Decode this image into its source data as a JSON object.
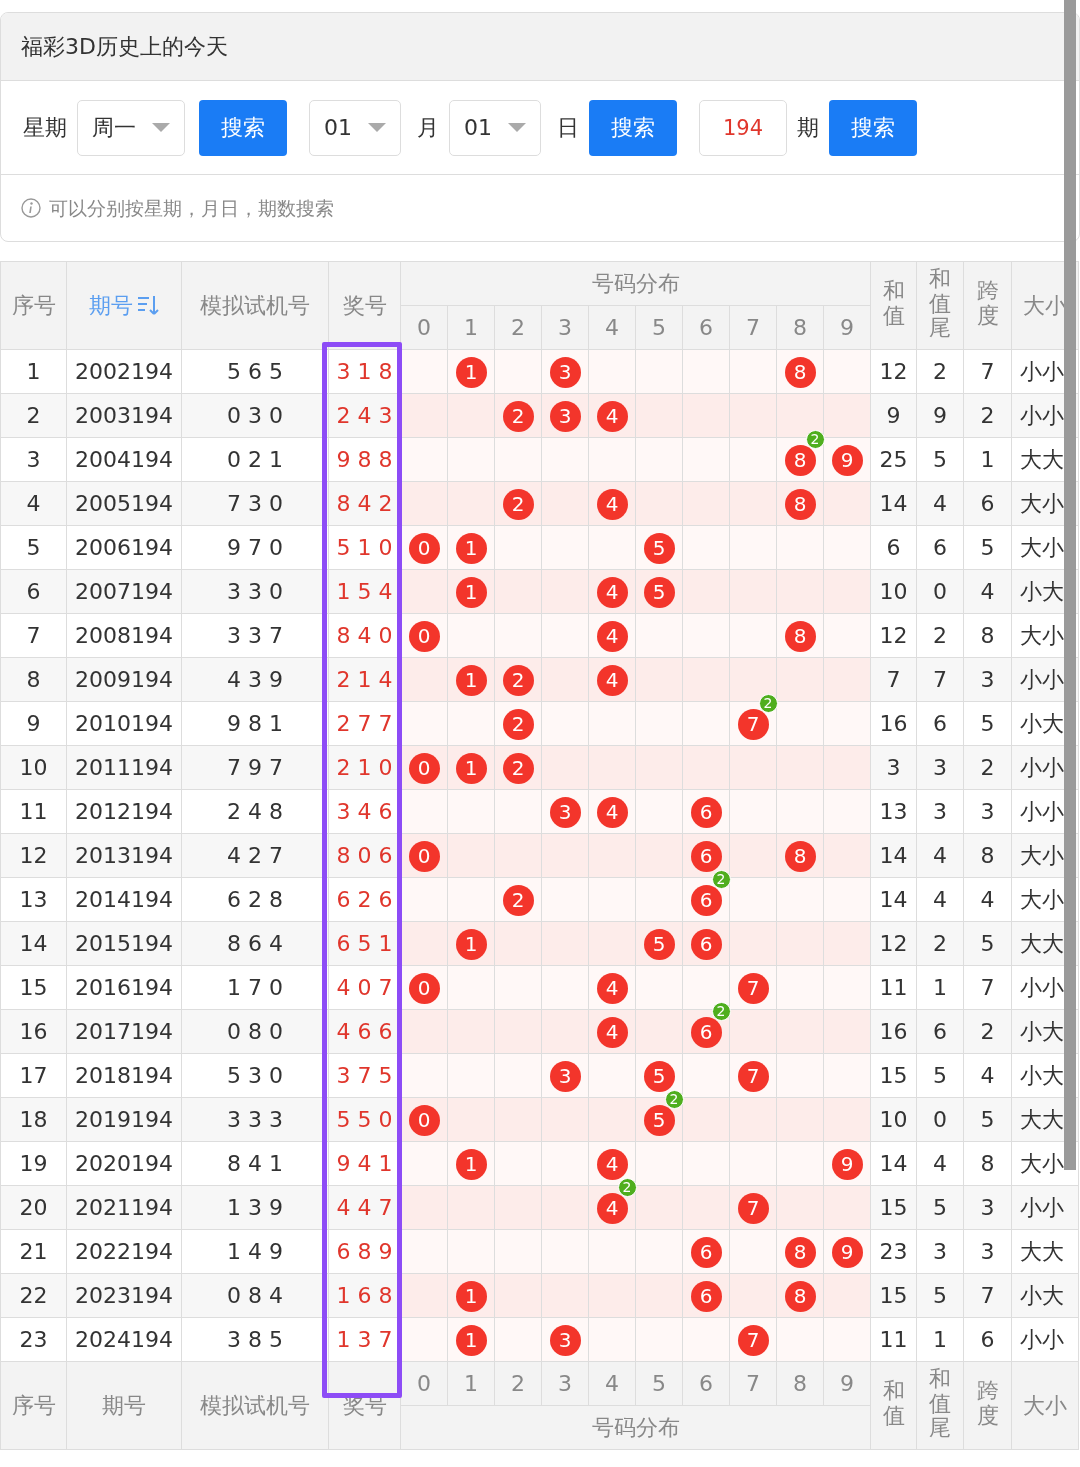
{
  "title": "福彩3D历史上的今天",
  "filters": [
    {
      "kind": "label",
      "text": "星期"
    },
    {
      "kind": "select",
      "value": "周一"
    },
    {
      "kind": "button",
      "text": "搜索"
    },
    {
      "kind": "select",
      "value": "01"
    },
    {
      "kind": "label",
      "text": "月"
    },
    {
      "kind": "select",
      "value": "01"
    },
    {
      "kind": "label",
      "text": "日"
    },
    {
      "kind": "button",
      "text": "搜索"
    },
    {
      "kind": "input",
      "value": "194"
    },
    {
      "kind": "label",
      "text": "期"
    },
    {
      "kind": "button",
      "text": "搜索"
    }
  ],
  "hint": "可以分别按星期，月日，期数搜索",
  "table": {
    "header": {
      "columns": [
        {
          "label": "序号",
          "selected": false
        },
        {
          "label": "期号",
          "selected": true
        },
        {
          "label": "模拟试机号",
          "selected": false
        },
        {
          "label": "奖号",
          "selected": false
        }
      ],
      "group": "号码分布",
      "digits": [
        "0",
        "1",
        "2",
        "3",
        "4",
        "5",
        "6",
        "7",
        "8",
        "9"
      ],
      "extra": [
        "和值",
        "和值尾",
        "跨度",
        "大小"
      ]
    },
    "rows": [
      {
        "no": "1",
        "issue": "2002194",
        "trial": "5 6 5",
        "draw": "3 1 8",
        "cells": [
          null,
          {
            "digit": "1"
          },
          null,
          {
            "digit": "3"
          },
          null,
          null,
          null,
          null,
          {
            "digit": "8"
          },
          null
        ],
        "sum": "12",
        "tail": "2",
        "span": "7",
        "size": "小小"
      },
      {
        "no": "2",
        "issue": "2003194",
        "trial": "0 3 0",
        "draw": "2 4 3",
        "cells": [
          null,
          null,
          {
            "digit": "2"
          },
          {
            "digit": "3"
          },
          {
            "digit": "4"
          },
          null,
          null,
          null,
          null,
          null
        ],
        "sum": "9",
        "tail": "9",
        "span": "2",
        "size": "小小"
      },
      {
        "no": "3",
        "issue": "2004194",
        "trial": "0 2 1",
        "draw": "9 8 8",
        "cells": [
          null,
          null,
          null,
          null,
          null,
          null,
          null,
          null,
          {
            "digit": "8",
            "badge": "2"
          },
          {
            "digit": "9"
          }
        ],
        "sum": "25",
        "tail": "5",
        "span": "1",
        "size": "大大"
      },
      {
        "no": "4",
        "issue": "2005194",
        "trial": "7 3 0",
        "draw": "8 4 2",
        "cells": [
          null,
          null,
          {
            "digit": "2"
          },
          null,
          {
            "digit": "4"
          },
          null,
          null,
          null,
          {
            "digit": "8"
          },
          null
        ],
        "sum": "14",
        "tail": "4",
        "span": "6",
        "size": "大小"
      },
      {
        "no": "5",
        "issue": "2006194",
        "trial": "9 7 0",
        "draw": "5 1 0",
        "cells": [
          {
            "digit": "0"
          },
          {
            "digit": "1"
          },
          null,
          null,
          null,
          {
            "digit": "5"
          },
          null,
          null,
          null,
          null
        ],
        "sum": "6",
        "tail": "6",
        "span": "5",
        "size": "大小"
      },
      {
        "no": "6",
        "issue": "2007194",
        "trial": "3 3 0",
        "draw": "1 5 4",
        "cells": [
          null,
          {
            "digit": "1"
          },
          null,
          null,
          {
            "digit": "4"
          },
          {
            "digit": "5"
          },
          null,
          null,
          null,
          null
        ],
        "sum": "10",
        "tail": "0",
        "span": "4",
        "size": "小大"
      },
      {
        "no": "7",
        "issue": "2008194",
        "trial": "3 3 7",
        "draw": "8 4 0",
        "cells": [
          {
            "digit": "0"
          },
          null,
          null,
          null,
          {
            "digit": "4"
          },
          null,
          null,
          null,
          {
            "digit": "8"
          },
          null
        ],
        "sum": "12",
        "tail": "2",
        "span": "8",
        "size": "大小"
      },
      {
        "no": "8",
        "issue": "2009194",
        "trial": "4 3 9",
        "draw": "2 1 4",
        "cells": [
          null,
          {
            "digit": "1"
          },
          {
            "digit": "2"
          },
          null,
          {
            "digit": "4"
          },
          null,
          null,
          null,
          null,
          null
        ],
        "sum": "7",
        "tail": "7",
        "span": "3",
        "size": "小小"
      },
      {
        "no": "9",
        "issue": "2010194",
        "trial": "9 8 1",
        "draw": "2 7 7",
        "cells": [
          null,
          null,
          {
            "digit": "2"
          },
          null,
          null,
          null,
          null,
          {
            "digit": "7",
            "badge": "2"
          },
          null,
          null
        ],
        "sum": "16",
        "tail": "6",
        "span": "5",
        "size": "小大"
      },
      {
        "no": "10",
        "issue": "2011194",
        "trial": "7 9 7",
        "draw": "2 1 0",
        "cells": [
          {
            "digit": "0"
          },
          {
            "digit": "1"
          },
          {
            "digit": "2"
          },
          null,
          null,
          null,
          null,
          null,
          null,
          null
        ],
        "sum": "3",
        "tail": "3",
        "span": "2",
        "size": "小小"
      },
      {
        "no": "11",
        "issue": "2012194",
        "trial": "2 4 8",
        "draw": "3 4 6",
        "cells": [
          null,
          null,
          null,
          {
            "digit": "3"
          },
          {
            "digit": "4"
          },
          null,
          {
            "digit": "6"
          },
          null,
          null,
          null
        ],
        "sum": "13",
        "tail": "3",
        "span": "3",
        "size": "小小"
      },
      {
        "no": "12",
        "issue": "2013194",
        "trial": "4 2 7",
        "draw": "8 0 6",
        "cells": [
          {
            "digit": "0"
          },
          null,
          null,
          null,
          null,
          null,
          {
            "digit": "6"
          },
          null,
          {
            "digit": "8"
          },
          null
        ],
        "sum": "14",
        "tail": "4",
        "span": "8",
        "size": "大小"
      },
      {
        "no": "13",
        "issue": "2014194",
        "trial": "6 2 8",
        "draw": "6 2 6",
        "cells": [
          null,
          null,
          {
            "digit": "2"
          },
          null,
          null,
          null,
          {
            "digit": "6",
            "badge": "2"
          },
          null,
          null,
          null
        ],
        "sum": "14",
        "tail": "4",
        "span": "4",
        "size": "大小"
      },
      {
        "no": "14",
        "issue": "2015194",
        "trial": "8 6 4",
        "draw": "6 5 1",
        "cells": [
          null,
          {
            "digit": "1"
          },
          null,
          null,
          null,
          {
            "digit": "5"
          },
          {
            "digit": "6"
          },
          null,
          null,
          null
        ],
        "sum": "12",
        "tail": "2",
        "span": "5",
        "size": "大大"
      },
      {
        "no": "15",
        "issue": "2016194",
        "trial": "1 7 0",
        "draw": "4 0 7",
        "cells": [
          {
            "digit": "0"
          },
          null,
          null,
          null,
          {
            "digit": "4"
          },
          null,
          null,
          {
            "digit": "7"
          },
          null,
          null
        ],
        "sum": "11",
        "tail": "1",
        "span": "7",
        "size": "小小"
      },
      {
        "no": "16",
        "issue": "2017194",
        "trial": "0 8 0",
        "draw": "4 6 6",
        "cells": [
          null,
          null,
          null,
          null,
          {
            "digit": "4"
          },
          null,
          {
            "digit": "6",
            "badge": "2"
          },
          null,
          null,
          null
        ],
        "sum": "16",
        "tail": "6",
        "span": "2",
        "size": "小大"
      },
      {
        "no": "17",
        "issue": "2018194",
        "trial": "5 3 0",
        "draw": "3 7 5",
        "cells": [
          null,
          null,
          null,
          {
            "digit": "3"
          },
          null,
          {
            "digit": "5"
          },
          null,
          {
            "digit": "7"
          },
          null,
          null
        ],
        "sum": "15",
        "tail": "5",
        "span": "4",
        "size": "小大"
      },
      {
        "no": "18",
        "issue": "2019194",
        "trial": "3 3 3",
        "draw": "5 5 0",
        "cells": [
          {
            "digit": "0"
          },
          null,
          null,
          null,
          null,
          {
            "digit": "5",
            "badge": "2"
          },
          null,
          null,
          null,
          null
        ],
        "sum": "10",
        "tail": "0",
        "span": "5",
        "size": "大大"
      },
      {
        "no": "19",
        "issue": "2020194",
        "trial": "8 4 1",
        "draw": "9 4 1",
        "cells": [
          null,
          {
            "digit": "1"
          },
          null,
          null,
          {
            "digit": "4"
          },
          null,
          null,
          null,
          null,
          {
            "digit": "9"
          }
        ],
        "sum": "14",
        "tail": "4",
        "span": "8",
        "size": "大小"
      },
      {
        "no": "20",
        "issue": "2021194",
        "trial": "1 3 9",
        "draw": "4 4 7",
        "cells": [
          null,
          null,
          null,
          null,
          {
            "digit": "4",
            "badge": "2"
          },
          null,
          null,
          {
            "digit": "7"
          },
          null,
          null
        ],
        "sum": "15",
        "tail": "5",
        "span": "3",
        "size": "小小"
      },
      {
        "no": "21",
        "issue": "2022194",
        "trial": "1 4 9",
        "draw": "6 8 9",
        "cells": [
          null,
          null,
          null,
          null,
          null,
          null,
          {
            "digit": "6"
          },
          null,
          {
            "digit": "8"
          },
          {
            "digit": "9"
          }
        ],
        "sum": "23",
        "tail": "3",
        "span": "3",
        "size": "大大"
      },
      {
        "no": "22",
        "issue": "2023194",
        "trial": "0 8 4",
        "draw": "1 6 8",
        "cells": [
          null,
          {
            "digit": "1"
          },
          null,
          null,
          null,
          null,
          {
            "digit": "6"
          },
          null,
          {
            "digit": "8"
          },
          null
        ],
        "sum": "15",
        "tail": "5",
        "span": "7",
        "size": "小大"
      },
      {
        "no": "23",
        "issue": "2024194",
        "trial": "3 8 5",
        "draw": "1 3 7",
        "cells": [
          null,
          {
            "digit": "1"
          },
          null,
          {
            "digit": "3"
          },
          null,
          null,
          null,
          {
            "digit": "7"
          },
          null,
          null
        ],
        "sum": "11",
        "tail": "1",
        "span": "6",
        "size": "小小"
      }
    ],
    "footer": {
      "columns": [
        "序号",
        "期号",
        "模拟试机号",
        "奖号"
      ],
      "digits": [
        "0",
        "1",
        "2",
        "3",
        "4",
        "5",
        "6",
        "7",
        "8",
        "9"
      ],
      "group": "号码分布",
      "extra": [
        "和值",
        "和值尾",
        "跨度",
        "大小"
      ]
    }
  }
}
